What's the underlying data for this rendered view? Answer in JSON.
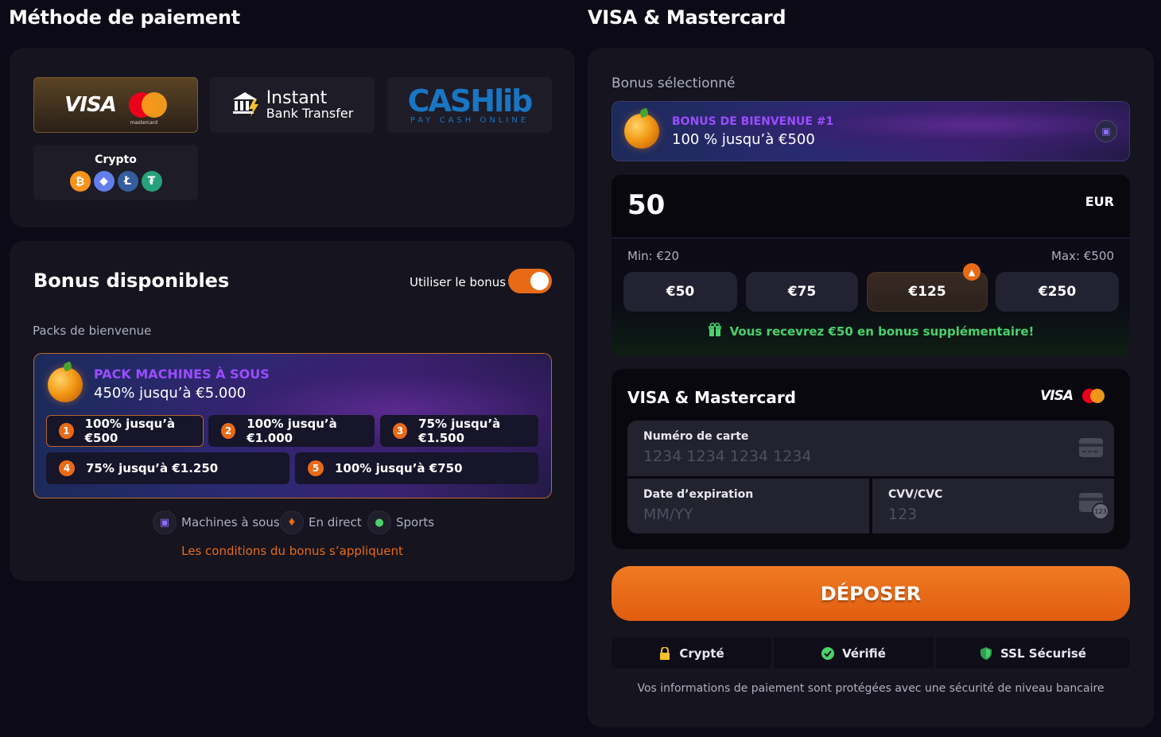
{
  "left": {
    "title": "Méthode de paiement",
    "methods": [
      {
        "name": "visa-mastercard",
        "visa": "VISA",
        "mc_label": "mastercard"
      },
      {
        "name": "instant-bank",
        "line1": "Instant",
        "line2": "Bank Transfer"
      },
      {
        "name": "cashlib",
        "line1": "CASHlib",
        "line2": "PAY CASH ONLINE"
      },
      {
        "name": "crypto",
        "label": "Crypto",
        "coins": [
          "₿",
          "◆",
          "Ł",
          "₮"
        ]
      }
    ],
    "bonus": {
      "title": "Bonus disponibles",
      "toggle_label": "Utiliser le bonus",
      "toggle_on": true,
      "packs_label": "Packs de bienvenue",
      "pack_title": "PACK MACHINES À SOUS",
      "pack_sub": "450% jusqu’à €5.000",
      "steps": [
        {
          "num": "1",
          "text": "100% jusqu’à €500"
        },
        {
          "num": "2",
          "text": "100% jusqu’à €1.000"
        },
        {
          "num": "3",
          "text": "75% jusqu’à €1.500"
        },
        {
          "num": "4",
          "text": "75% jusqu’à €1.250"
        },
        {
          "num": "5",
          "text": "100% jusqu’à €750"
        }
      ],
      "categories": [
        "Machines à sous",
        "En direct",
        "Sports"
      ],
      "terms": "Les conditions du bonus s’appliquent"
    }
  },
  "right": {
    "title": "VISA & Mastercard",
    "selected_label": "Bonus sélectionné",
    "selected_title": "BONUS DE BIENVENUE #1",
    "selected_sub": "100 % jusqu’à €500",
    "amount": "50",
    "currency": "EUR",
    "min": "Min: €20",
    "max": "Max: €500",
    "quick_amounts": [
      "€50",
      "€75",
      "€125",
      "€250"
    ],
    "bonus_note": "Vous recevrez €50 en bonus supplémentaire!",
    "card_section": {
      "title": "VISA & Mastercard",
      "visa": "VISA",
      "number_label": "Numéro de carte",
      "number_placeholder": "1234 1234 1234 1234",
      "expiry_label": "Date d’expiration",
      "expiry_placeholder": "MM/YY",
      "cvv_label": "CVV/CVC",
      "cvv_placeholder": "123",
      "cvv_badge": "123"
    },
    "deposit_label": "DÉPOSER",
    "trust": [
      "Crypté",
      "Vérifié",
      "SSL Sécurisé"
    ],
    "footer": "Vos informations de paiement sont protégées avec une sécurité de niveau bancaire"
  },
  "colors": {
    "accent": "#e86a17",
    "purple": "#9b4dff",
    "green": "#4ad26b"
  }
}
